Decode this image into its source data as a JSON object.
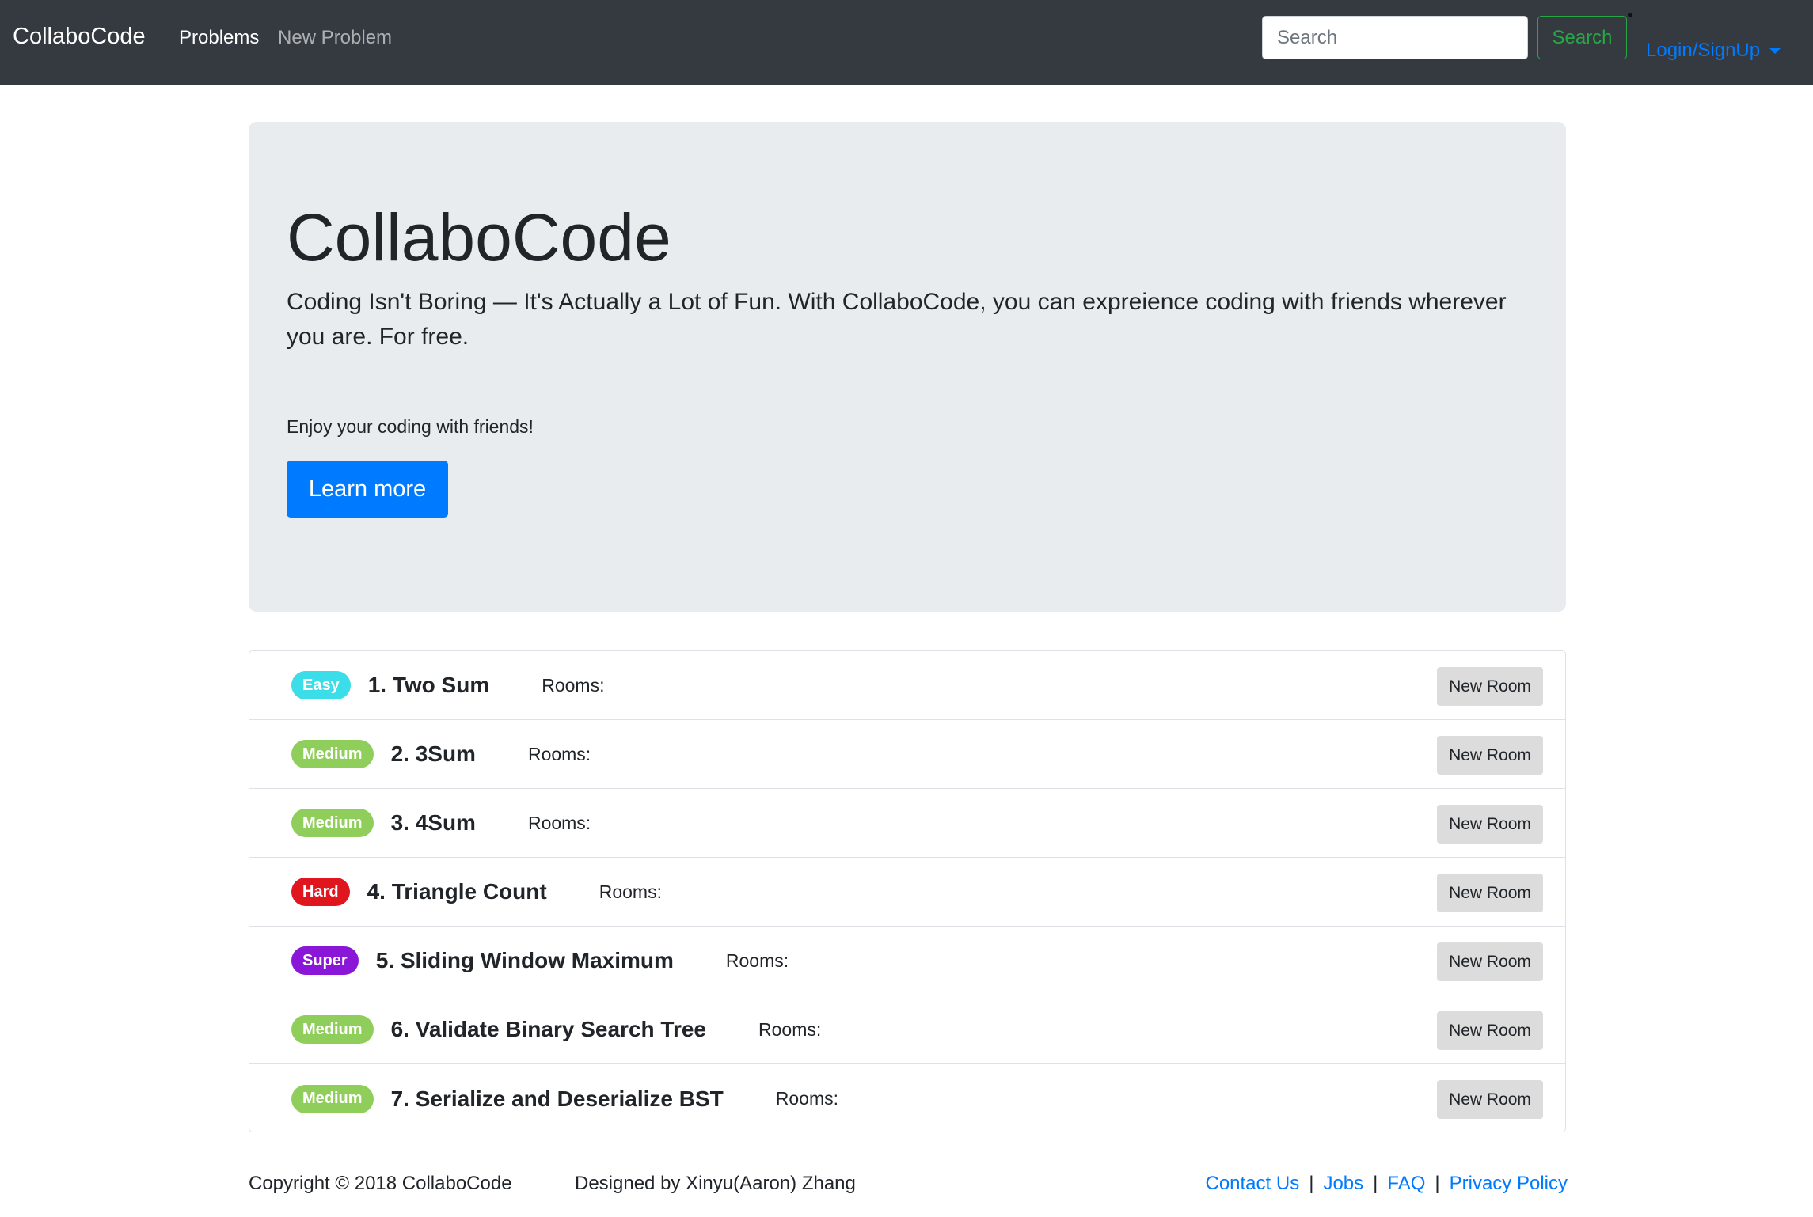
{
  "navbar": {
    "brand": "CollaboCode",
    "links": [
      "Problems",
      "New Problem"
    ],
    "search_placeholder": "Search",
    "search_button": "Search",
    "login": "Login/SignUp"
  },
  "jumbotron": {
    "title": "CollaboCode",
    "lead": "Coding Isn't Boring — It's Actually a Lot of Fun. With CollaboCode, you can expreience coding with friends wherever you are. For free.",
    "tagline": "Enjoy your coding with friends!",
    "button": "Learn more"
  },
  "rooms_label": "Rooms:",
  "new_room_label": "New Room",
  "problems": [
    {
      "difficulty": "Easy",
      "title": "1. Two Sum",
      "color": "#3bdde8"
    },
    {
      "difficulty": "Medium",
      "title": "2. 3Sum",
      "color": "#8fce5a"
    },
    {
      "difficulty": "Medium",
      "title": "3. 4Sum",
      "color": "#8fce5a"
    },
    {
      "difficulty": "Hard",
      "title": "4. Triangle Count",
      "color": "#e0161f"
    },
    {
      "difficulty": "Super",
      "title": "5. Sliding Window Maximum",
      "color": "#8a17d8"
    },
    {
      "difficulty": "Medium",
      "title": "6. Validate Binary Search Tree",
      "color": "#8fce5a"
    },
    {
      "difficulty": "Medium",
      "title": "7. Serialize and Deserialize BST",
      "color": "#8fce5a"
    }
  ],
  "footer": {
    "copyright": "Copyright © 2018 CollaboCode",
    "designed": "Designed by Xinyu(Aaron) Zhang",
    "links": [
      "Contact Us",
      "Jobs",
      "FAQ",
      "Privacy Policy"
    ],
    "separator": "|"
  }
}
